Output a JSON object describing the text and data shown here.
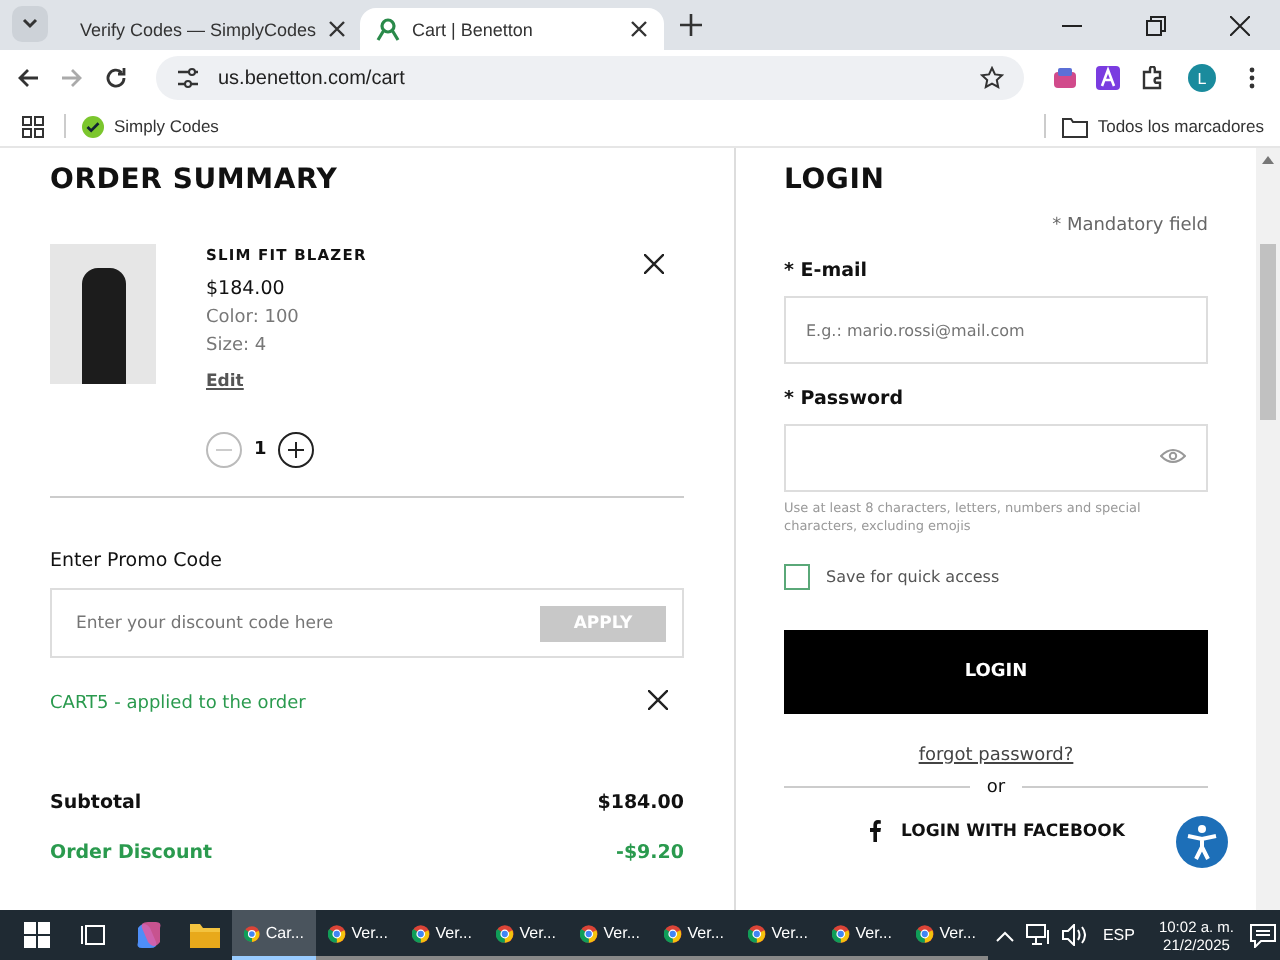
{
  "browser": {
    "tabs": [
      {
        "title": "Verify Codes — SimplyCodes",
        "selected": false
      },
      {
        "title": "Cart | Benetton",
        "selected": true
      }
    ],
    "url": "us.benetton.com/cart",
    "bookmarks": [
      {
        "label": "Simply Codes"
      }
    ],
    "all_bookmarks": "Todos los marcadores",
    "profile_initial": "L"
  },
  "order_summary": {
    "title": "ORDER SUMMARY",
    "item": {
      "name": "SLIM FIT BLAZER",
      "price": "$184.00",
      "color_label": "Color: 100",
      "size": "Size: 4",
      "edit": "Edit",
      "quantity": "1"
    },
    "promo": {
      "label": "Enter Promo Code",
      "placeholder": "Enter your discount code here",
      "apply": "APPLY",
      "applied": "CART5 - applied to the order"
    },
    "totals": [
      {
        "label": "Subtotal",
        "value": "$184.00",
        "kind": "plain"
      },
      {
        "label": "Order Discount",
        "value": "-$9.20",
        "kind": "discount"
      }
    ]
  },
  "login": {
    "title": "LOGIN",
    "mandatory": "* Mandatory field",
    "email_label": "* E-mail",
    "email_placeholder": "E.g.: mario.rossi@mail.com",
    "password_label": "* Password",
    "password_hint": "Use at least 8 characters, letters, numbers and special characters, excluding emojis",
    "save": {
      "label": "Save for quick access",
      "checked": false
    },
    "button": "LOGIN",
    "forgot": "forgot password?",
    "or": "or",
    "facebook": "LOGIN WITH FACEBOOK"
  },
  "taskbar": {
    "windows": [
      {
        "label": "Car...",
        "selected": true
      },
      {
        "label": "Ver...",
        "selected": false
      },
      {
        "label": "Ver...",
        "selected": false
      },
      {
        "label": "Ver...",
        "selected": false
      },
      {
        "label": "Ver...",
        "selected": false
      },
      {
        "label": "Ver...",
        "selected": false
      },
      {
        "label": "Ver...",
        "selected": false
      },
      {
        "label": "Ver...",
        "selected": false
      },
      {
        "label": "Ver...",
        "selected": false
      }
    ],
    "language": "ESP",
    "time": "10:02 a. m.",
    "date": "21/2/2025"
  }
}
